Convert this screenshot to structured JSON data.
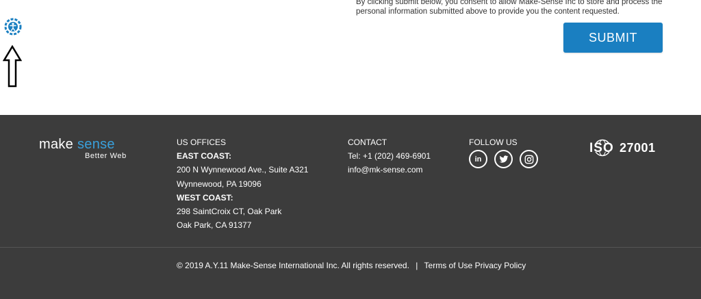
{
  "form": {
    "consent_text_line1": "By clicking submit below, you consent to allow Make-Sense Inc to store and process the",
    "consent_text_line2": "personal information submitted above to provide you the content requested.",
    "submit_label": "SUBMIT"
  },
  "footer": {
    "logo": {
      "word1": "make",
      "word2": "sense",
      "tagline": "Better Web"
    },
    "offices": {
      "heading": "US OFFICES",
      "east_label": "EAST COAST:",
      "east_line1": "200 N Wynnewood Ave., Suite A321",
      "east_line2": "Wynnewood, PA 19096",
      "west_label": "WEST COAST:",
      "west_line1": "298 SaintCroix CT, Oak Park",
      "west_line2": "Oak Park, CA 91377"
    },
    "contact": {
      "heading": "CONTACT",
      "phone": "Tel: +1 (202) 469-6901",
      "email": "info@mk-sense.com"
    },
    "follow": {
      "heading": "FOLLOW US",
      "linkedin_glyph": "in"
    },
    "iso": {
      "badge_text": "ISO",
      "number": "27001"
    },
    "copyright": "© 2019 A.Y.11 Make-Sense International Inc. All rights reserved.",
    "separator": "|",
    "terms_label": "Terms of Use",
    "privacy_label": "Privacy Policy"
  },
  "colors": {
    "accent": "#1a7fc1",
    "logo_accent": "#39a0dc",
    "footer_bg": "#3c3c3c"
  },
  "icons": {
    "accessibility": "accessibility-icon",
    "arrow": "up-arrow-icon",
    "linkedin": "linkedin-icon",
    "twitter": "twitter-icon",
    "instagram": "instagram-icon"
  }
}
